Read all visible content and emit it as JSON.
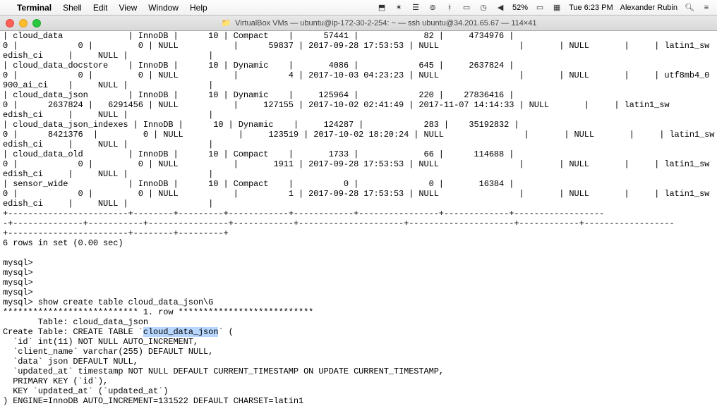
{
  "menubar": {
    "app": "Terminal",
    "items": [
      "Shell",
      "Edit",
      "View",
      "Window",
      "Help"
    ],
    "battery": "52%",
    "clock": "Tue 6:23 PM",
    "user": "Alexander Rubin"
  },
  "titlebar": {
    "icon": "📁",
    "text": "VirtualBox VMs — ubuntu@ip-172-30-2-254: ~ — ssh ubuntu@34.201.65.67 — 114×41"
  },
  "term": {
    "rows": [
      "| cloud_data             | InnoDB |      10 | Compact    |      57441 |             82 |     4734976 |",
      "0 |            0 |         0 | NULL           |      59837 | 2017-09-28 17:53:53 | NULL                |       | NULL       |     | latin1_sw",
      "edish_ci     |     NULL |                |",
      "| cloud_data_docstore    | InnoDB |      10 | Dynamic    |       4086 |            645 |     2637824 |",
      "0 |            0 |         0 | NULL           |          4 | 2017-10-03 04:23:23 | NULL                |       | NULL       |     | utf8mb4_0",
      "900_ai_ci    |     NULL |                |",
      "| cloud_data_json        | InnoDB |      10 | Dynamic    |     125964 |            220 |    27836416 |",
      "0 |      2637824 |   6291456 | NULL           |     127155 | 2017-10-02 02:41:49 | 2017-11-07 14:14:33 | NULL       |     | latin1_sw",
      "edish_ci     |     NULL |                |",
      "| cloud_data_json_indexes | InnoDB |      10 | Dynamic    |     124287 |            283 |    35192832 |",
      "0 |      8421376  |         0 | NULL           |     123519 | 2017-10-02 18:20:24 | NULL                |       | NULL       |     | latin1_sw",
      "edish_ci     |     NULL |                |",
      "| cloud_data_old         | InnoDB |      10 | Compact    |       1733 |             66 |      114688 |",
      "0 |            0 |         0 | NULL           |       1911 | 2017-09-28 17:53:53 | NULL                |       | NULL       |     | latin1_sw",
      "edish_ci     |     NULL |                |",
      "| sensor_wide            | InnoDB |      10 | Compact    |          0 |              0 |       16384 |",
      "0 |            0 |         0 | NULL           |          1 | 2017-09-28 17:53:53 | NULL                |       | NULL       |     | latin1_sw",
      "edish_ci     |     NULL |                |",
      "+------------------------+--------+---------+------------+------------+----------------+-------------+------------------",
      "-+--------------+-----------+----------------+------------+---------------------+---------------------+------------+------------------",
      "+------------------------+--------+---------+",
      "6 rows in set (0.00 sec)",
      "",
      "mysql>",
      "mysql>",
      "mysql>",
      "mysql>",
      "mysql> show create table cloud_data_json\\G",
      "*************************** 1. row ***************************",
      "       Table: cloud_data_json"
    ],
    "create_pre": "Create Table: CREATE TABLE `",
    "create_hl": "cloud_data_json",
    "create_post": "` (",
    "rows2": [
      "  `id` int(11) NOT NULL AUTO_INCREMENT,",
      "  `client_name` varchar(255) DEFAULT NULL,",
      "  `data` json DEFAULT NULL,",
      "  `updated_at` timestamp NOT NULL DEFAULT CURRENT_TIMESTAMP ON UPDATE CURRENT_TIMESTAMP,",
      "  PRIMARY KEY (`id`),",
      "  KEY `updated_at` (`updated_at`)",
      ") ENGINE=InnoDB AUTO_INCREMENT=131522 DEFAULT CHARSET=latin1"
    ]
  }
}
